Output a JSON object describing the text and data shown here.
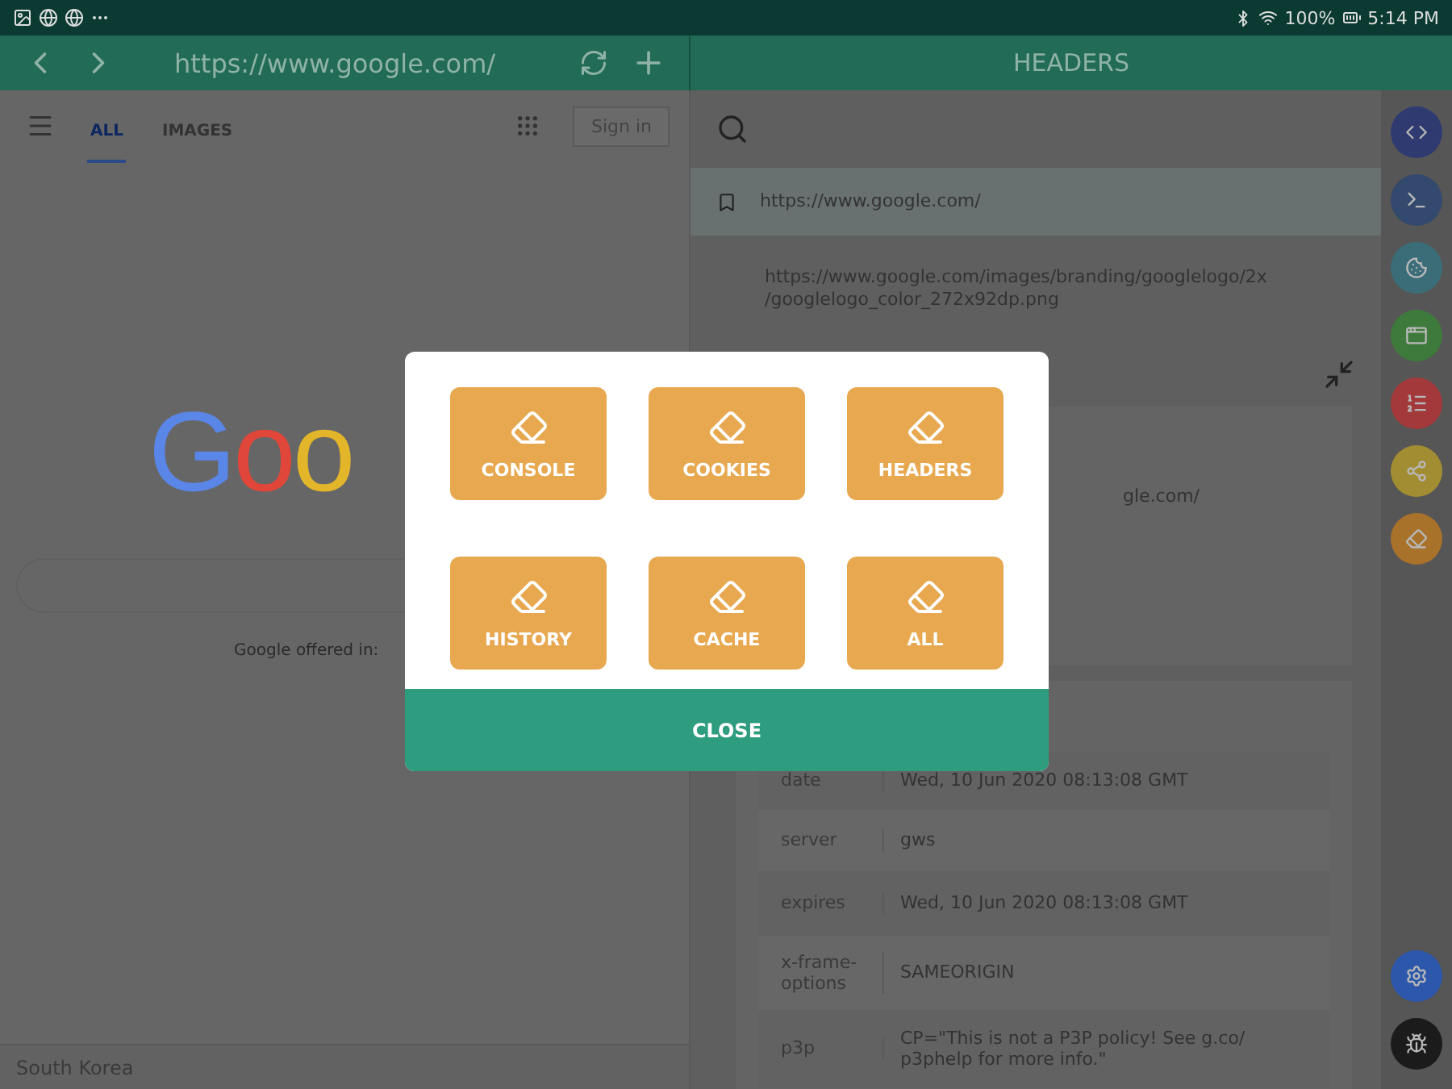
{
  "status_bar": {
    "battery": "100%",
    "time": "5:14 PM"
  },
  "browser": {
    "url": "https://www.google.com/",
    "tabs": [
      {
        "label": "ALL",
        "selected": true
      },
      {
        "label": "IMAGES",
        "selected": false
      }
    ],
    "sign_in": "Sign in",
    "logo": "Goo",
    "offered_in": "Google offered in:",
    "footer": "South Korea"
  },
  "inspector": {
    "title": "HEADERS",
    "page_url": "https://www.google.com/",
    "resource_url": "https://www.google.com/images/branding/googlelogo/2x\n/googlelogo_color_272x92dp.png",
    "partial_url": "gle.com/",
    "headers": [
      {
        "name": "date",
        "value": "Wed, 10 Jun 2020 08:13:08 GMT"
      },
      {
        "name": "server",
        "value": "gws"
      },
      {
        "name": "expires",
        "value": "Wed, 10 Jun 2020 08:13:08 GMT"
      },
      {
        "name": "x-frame-\noptions",
        "value": "SAMEORIGIN"
      },
      {
        "name": "p3p",
        "value": "CP=\"This is not a P3P policy! See g.co/\np3phelp for more info.\""
      }
    ]
  },
  "rail": [
    {
      "kind": "code",
      "color": "#2e3a70"
    },
    {
      "kind": "terminal",
      "color": "#34496e"
    },
    {
      "kind": "cookie",
      "color": "#3b6d79"
    },
    {
      "kind": "window",
      "color": "#3e7a3c"
    },
    {
      "kind": "list",
      "color": "#a3393b"
    },
    {
      "kind": "share",
      "color": "#a38d32"
    },
    {
      "kind": "eraser",
      "color": "#a9722b"
    }
  ],
  "rail_bottom": [
    {
      "kind": "settings",
      "color": "#2c57aa"
    },
    {
      "kind": "bug",
      "color": "#1b1b1b"
    }
  ],
  "dialog": {
    "buttons": [
      "CONSOLE",
      "COOKIES",
      "HEADERS",
      "HISTORY",
      "CACHE",
      "ALL"
    ],
    "close": "CLOSE"
  }
}
